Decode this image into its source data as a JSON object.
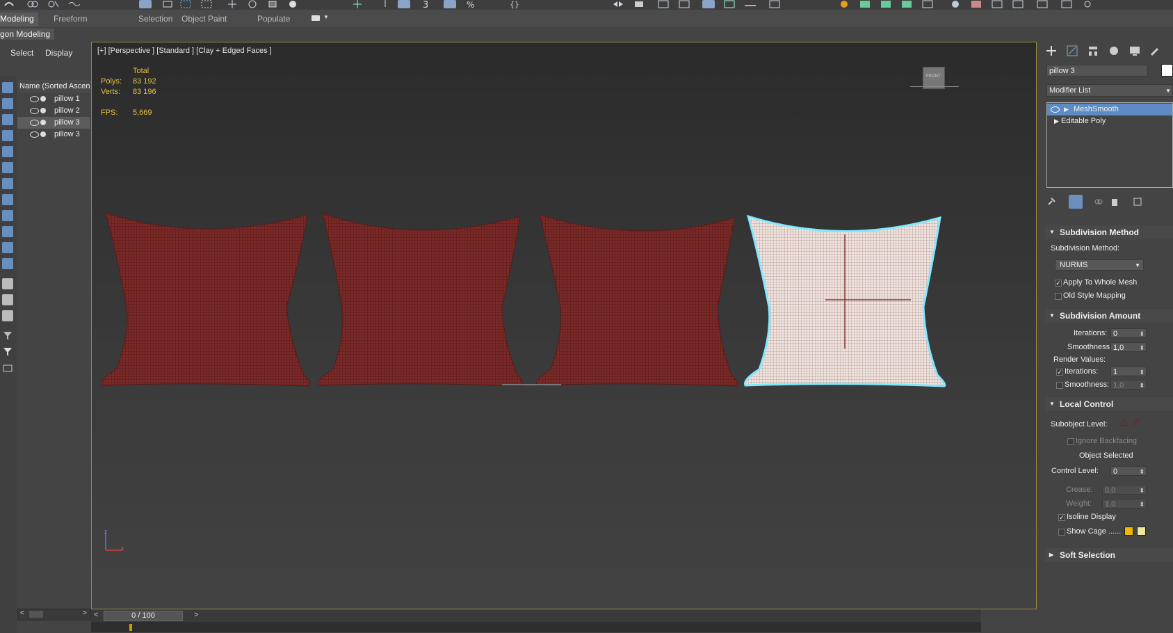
{
  "ribbon": {
    "tabs": [
      {
        "label": "Modeling",
        "active": true
      },
      {
        "label": "Freeform"
      },
      {
        "label": "Selection"
      },
      {
        "label": "Object Paint"
      },
      {
        "label": "Populate"
      }
    ],
    "panel_label": "gon Modeling"
  },
  "scene_explorer": {
    "tabs": [
      "Select",
      "Display"
    ],
    "column_header": "Name (Sorted Ascen",
    "rows": [
      {
        "name": "pillow 1",
        "selected": false
      },
      {
        "name": "pillow 2",
        "selected": false
      },
      {
        "name": "pillow 3",
        "selected": true
      },
      {
        "name": "pillow 3",
        "selected": false
      }
    ]
  },
  "viewport": {
    "label": "[+] [Perspective ] [Standard ] [Clay + Edged Faces ]",
    "stats": {
      "total_label": "Total",
      "polys_label": "Polys:",
      "polys_value": "83 192",
      "verts_label": "Verts:",
      "verts_value": "83 196",
      "fps_label": "FPS:",
      "fps_value": "5,669"
    },
    "viewcube_label": "FRONT",
    "objects": [
      {
        "name": "pillow 1",
        "color": "#7a2a28",
        "selected": false
      },
      {
        "name": "pillow 2",
        "color": "#7a2a28",
        "selected": false
      },
      {
        "name": "pillow 3",
        "color": "#7a2a28",
        "selected": false
      },
      {
        "name": "pillow 3",
        "color": "#e8dcd6",
        "selected": true
      }
    ],
    "axis_labels": {
      "z": "z",
      "x": "x"
    }
  },
  "timeline": {
    "frame": "0 / 100"
  },
  "command_panel": {
    "object_name": "pillow 3",
    "object_color": "#ffffff",
    "modifier_list_label": "Modifier List",
    "stack": [
      {
        "label": "MeshSmooth",
        "selected": true
      },
      {
        "label": "Editable Poly",
        "selected": false
      }
    ],
    "subdivision_method": {
      "title": "Subdivision Method",
      "method_label": "Subdivision Method:",
      "method_value": "NURMS",
      "apply_whole_mesh": "Apply To Whole Mesh",
      "apply_whole_mesh_checked": true,
      "old_style_mapping": "Old Style Mapping",
      "old_style_mapping_checked": false
    },
    "subdivision_amount": {
      "title": "Subdivision Amount",
      "iterations_label": "Iterations:",
      "iterations_value": "0",
      "smoothness_label": "Smoothness:",
      "smoothness_value": "1,0",
      "render_values_label": "Render Values:",
      "render_iterations_label": "Iterations:",
      "render_iterations_value": "1",
      "render_iterations_checked": true,
      "render_smoothness_label": "Smoothness:",
      "render_smoothness_value": "1,0",
      "render_smoothness_checked": false
    },
    "local_control": {
      "title": "Local Control",
      "subobject_label": "Subobject Level:",
      "ignore_backfacing": "Ignore Backfacing",
      "object_selected": "Object Selected",
      "control_level_label": "Control Level:",
      "control_level_value": "0",
      "crease_label": "Crease:",
      "crease_value": "0,0",
      "weight_label": "Weight:",
      "weight_value": "1,0",
      "isoline_display": "Isoline Display",
      "isoline_checked": true,
      "show_cage": "Show Cage ......",
      "show_cage_checked": false,
      "cage_color_1": "#f2b705",
      "cage_color_2": "#ede69a"
    },
    "soft_selection": {
      "title": "Soft Selection"
    }
  }
}
